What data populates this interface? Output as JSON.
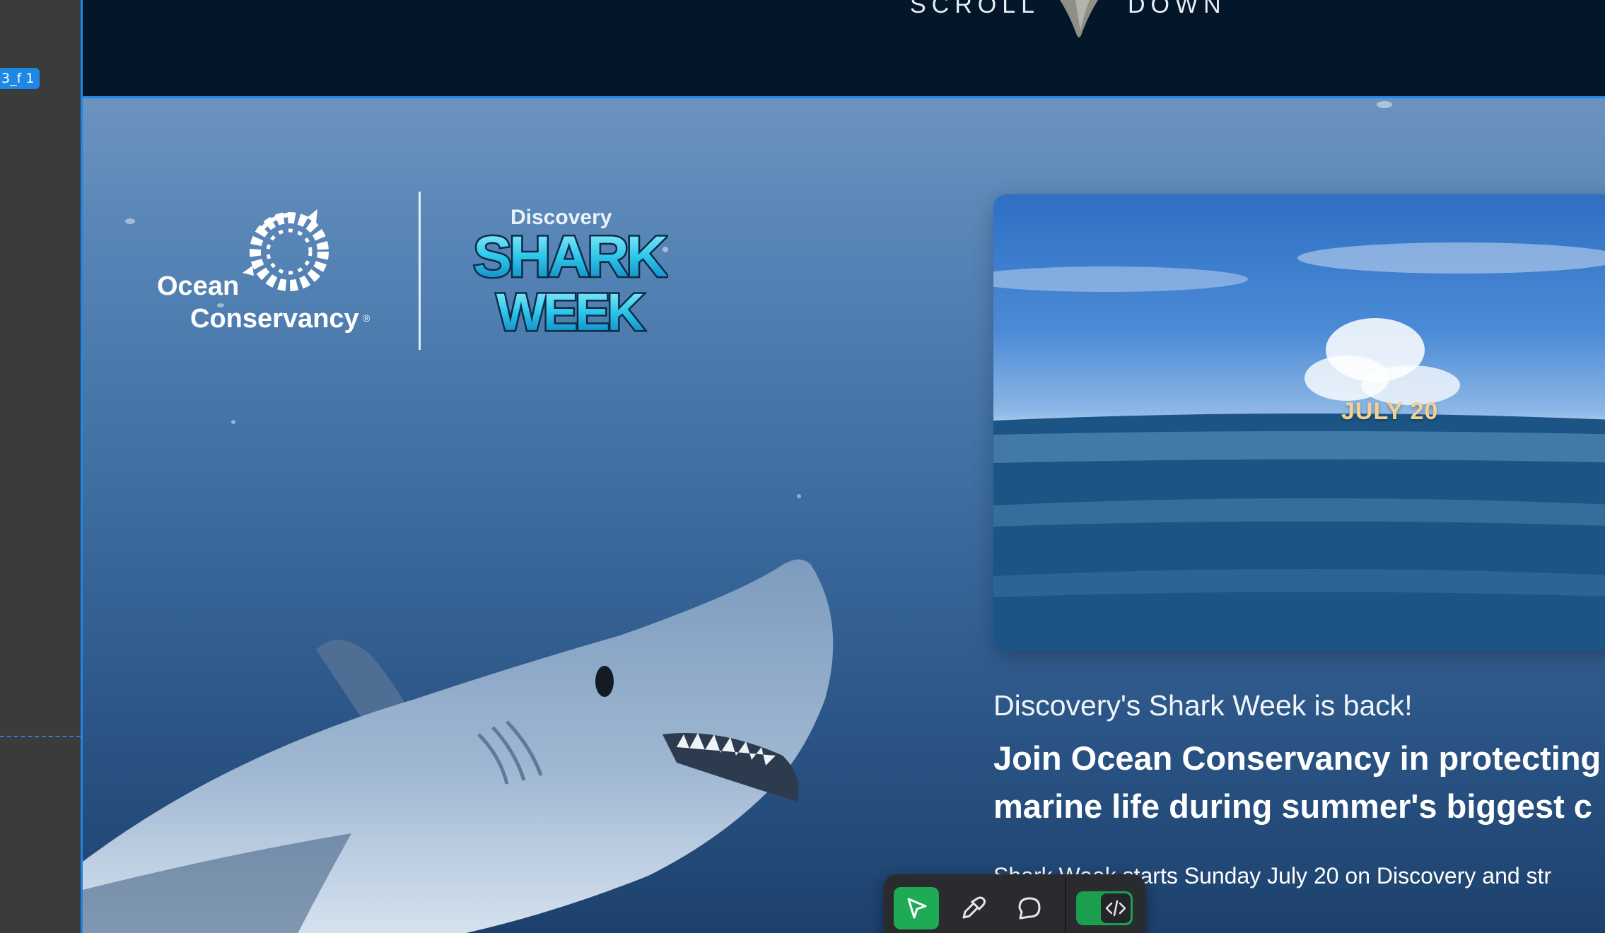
{
  "editor": {
    "frame_tag": "3_f 1"
  },
  "top_band": {
    "scroll_left": "SCROLL",
    "scroll_right": "DOWN"
  },
  "logos": {
    "ocean_line1": "Ocean",
    "ocean_line2": "Conservancy",
    "ocean_registered": "®",
    "discovery": "Discovery",
    "shark": "SHARK",
    "week": "WEEK"
  },
  "video": {
    "date_text": "JULY 20"
  },
  "copy": {
    "kicker": "Discovery's Shark Week is back!",
    "headline_line1": "Join Ocean Conservancy in protecting",
    "headline_line2": "marine life during summer's biggest c",
    "body": "Shark Week starts Sunday July 20 on Discovery and str"
  },
  "toolbar": {
    "select_icon": "pointer-arrow-icon",
    "eyedropper_icon": "eyedropper-icon",
    "comment_icon": "speech-bubble-icon",
    "code_icon": "code-brackets-icon"
  },
  "colors": {
    "frame_blue": "#1f86e8",
    "top_band": "#041629",
    "toolbar_green": "#1faa55"
  }
}
